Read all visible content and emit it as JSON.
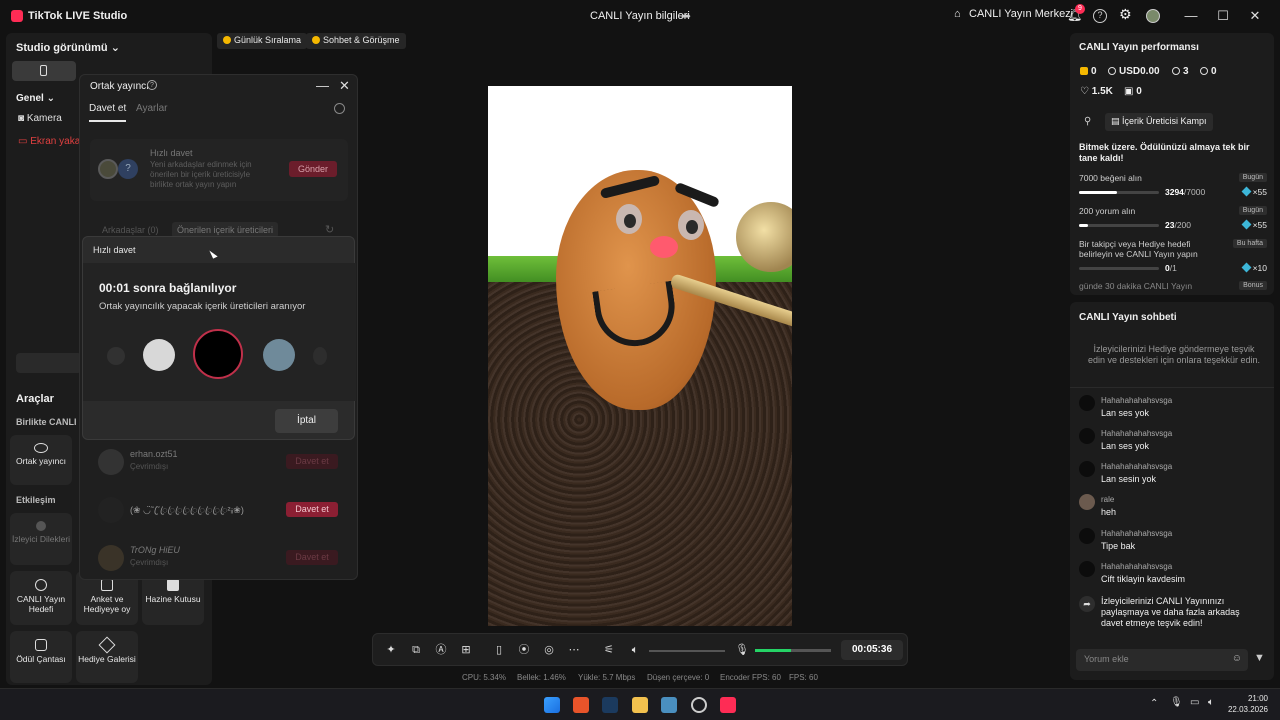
{
  "titlebar": {
    "app_name": "TikTok LIVE Studio",
    "center_title": "CANLI Yayın bilgileri",
    "center_right": "CANLI Yayın Merkezi",
    "notification_count": "9"
  },
  "sidebar": {
    "title": "Studio görünümü",
    "general_label": "Genel",
    "sources": [
      "Kamera",
      "Ekran yaka"
    ],
    "tools_label": "Araçlar",
    "collab_label": "Birlikte CANLI Y",
    "interaction_label": "Etkileşim",
    "tools": {
      "co_host": "Ortak yayıncı",
      "viewer_wishes": "İzleyici Dilekleri",
      "live_gift": "CANLI Yayın Hedefi",
      "poll": "Anket ve Hediyeye oy",
      "treasure": "Hazine Kutusu",
      "reward_bag": "Ödül Çantası",
      "gift_gallery": "Hediye Galerisi"
    }
  },
  "chips": [
    "Günlük Sıralama",
    "Sohbet & Görüşme"
  ],
  "cohost_dialog": {
    "title": "Ortak yayıncı",
    "tabs": [
      "Davet et",
      "Ayarlar"
    ],
    "quick_invite_title": "Hızlı davet",
    "quick_invite_desc": "Yeni arkadaşlar edinmek için önerilen bir içerik üreticisiyle birlikte ortak yayın yapın",
    "quick_invite_button": "Gönder",
    "friends_tab": "Arkadaşlar (0)",
    "suggested_tab": "Önerilen içerik üreticileri",
    "users": [
      {
        "name": "erhan.ozt51",
        "status": "Çevrimdışı",
        "button": "Davet et"
      },
      {
        "name": "(❀ ◡̈˜˜ꦿꦿꦿꦿꦿꦿꦿꦿꦿꦿ²ᵢᵢ❀)",
        "status": "",
        "button": "Davet et"
      },
      {
        "name": "TrONg HiEU",
        "status": "Çevrimdışı",
        "button": "Davet et"
      }
    ]
  },
  "quick_invite_overlay": {
    "header": "Hızlı davet",
    "countdown": "00:01 sonra bağlanılıyor",
    "subtitle": "Ortak yayıncılık yapacak içerik üreticileri aranıyor",
    "cancel": "İptal"
  },
  "controls": {
    "timer": "00:05:36",
    "mic_level": 0.48
  },
  "stats": {
    "cpu": "CPU: 5.34%",
    "memory": "Bellek: 1.46%",
    "upload": "Yükle: 5.7 Mbps",
    "dropped": "Düşen çerçeve: 0",
    "encoder": "Encoder FPS: 60",
    "fps": "FPS: 60"
  },
  "performance": {
    "title": "CANLI Yayın performansı",
    "diamonds": "0",
    "usd": "USD0.00",
    "viewers": "3",
    "followers": "0",
    "likes": "1.5K",
    "gifts": "0",
    "camp_button": "İçerik Üreticisi Kampı",
    "camp_desc": "Bitmek üzere. Ödülünüzü almaya tek bir tane kaldı!",
    "tasks": [
      {
        "name": "7000 beğeni alın",
        "badge": "Bugün",
        "done": "3294",
        "total": "/7000",
        "fraction": 0.47,
        "reward": "×55"
      },
      {
        "name": "200 yorum alın",
        "badge": "Bugün",
        "done": "23",
        "total": "/200",
        "fraction": 0.115,
        "reward": "×55"
      },
      {
        "name": "Bir takipçi veya Hediye hedefi belirleyin ve CANLI Yayın yapın",
        "badge": "Bu hafta",
        "done": "0",
        "total": "/1",
        "fraction": 0,
        "reward": "×10"
      },
      {
        "name": "günde 30 dakika CANLI Yayın",
        "badge": "Bonus",
        "done": "",
        "total": "",
        "fraction": 0,
        "reward": ""
      }
    ]
  },
  "chat": {
    "title": "CANLI Yayın sohbeti",
    "info": "İzleyicilerinizi Hediye göndermeye teşvik edin ve destekleri için onlara teşekkür edin.",
    "messages": [
      {
        "user": "Hahahahahahsvsga",
        "text": "Lan ses yok"
      },
      {
        "user": "Hahahahahahsvsga",
        "text": "Lan ses yok"
      },
      {
        "user": "Hahahahahahsvsga",
        "text": "Lan sesin yok"
      },
      {
        "user": "rale",
        "text": "heh"
      },
      {
        "user": "Hahahahahahsvsga",
        "text": "Tipe bak"
      },
      {
        "user": "Hahahahahahsvsga",
        "text": "Cift tiklayin kavdesim"
      }
    ],
    "share_prompt": "İzleyicilerinizi CANLI Yayınınızı paylaşmaya ve daha fazla arkadaş davet etmeye teşvik edin!",
    "comment_placeholder": "Yorum ekle"
  },
  "taskbar": {
    "time": "21:00",
    "date": "22.03.2026"
  }
}
